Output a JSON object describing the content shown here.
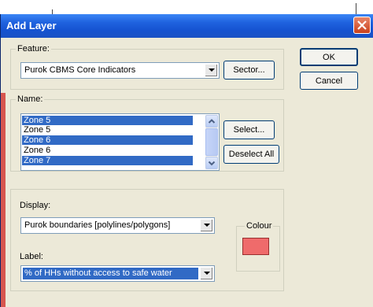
{
  "window": {
    "title": "Add Layer"
  },
  "feature": {
    "legend": "Feature:",
    "value": "Purok CBMS Core Indicators",
    "sector_button": "Sector..."
  },
  "actions": {
    "ok": "OK",
    "cancel": "Cancel"
  },
  "name": {
    "legend": "Name:",
    "items": [
      {
        "label": "Zone 5",
        "selected": true
      },
      {
        "label": "Zone 5",
        "selected": false
      },
      {
        "label": "Zone 6",
        "selected": true
      },
      {
        "label": "Zone 6",
        "selected": false
      },
      {
        "label": "Zone 7",
        "selected": true
      }
    ],
    "select_button": "Select...",
    "deselect_button": "Deselect All"
  },
  "display": {
    "label": "Display:",
    "value": "Purok boundaries [polylines/polygons]",
    "colour_legend": "Colour",
    "colour_value": "#ef6b6b"
  },
  "label_field": {
    "label": "Label:",
    "value": "% of HHs without access to safe water"
  }
}
